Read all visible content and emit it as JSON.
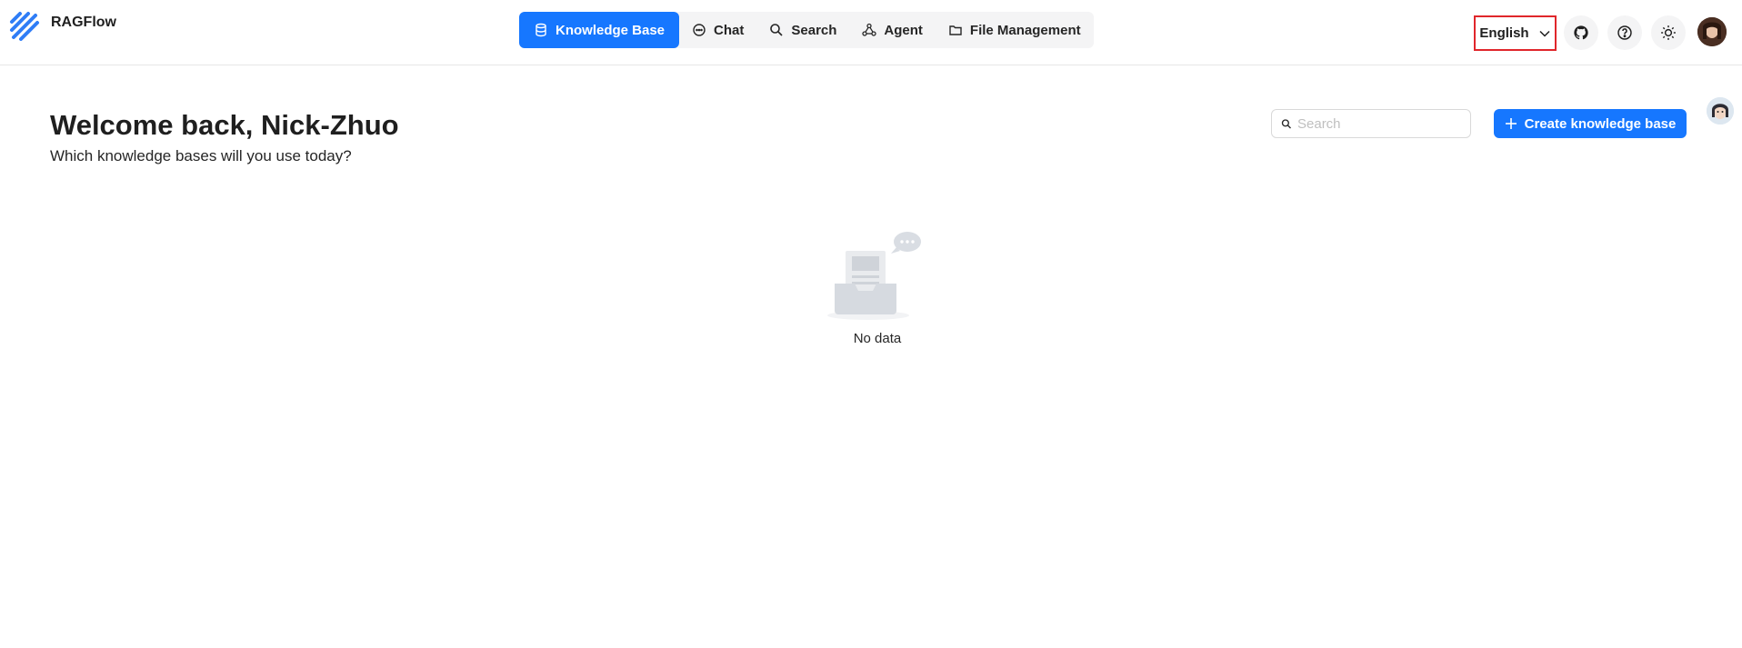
{
  "app": {
    "name": "RAGFlow"
  },
  "nav": {
    "items": [
      {
        "label": "Knowledge Base",
        "icon": "database-icon",
        "active": true
      },
      {
        "label": "Chat",
        "icon": "chat-bubble-icon"
      },
      {
        "label": "Search",
        "icon": "search-icon"
      },
      {
        "label": "Agent",
        "icon": "agent-graph-icon"
      },
      {
        "label": "File Management",
        "icon": "folder-icon"
      }
    ]
  },
  "header": {
    "language": "English",
    "icons": [
      "github-icon",
      "help-icon",
      "sun-icon"
    ]
  },
  "main": {
    "welcome": "Welcome back, Nick-Zhuo",
    "subtitle": "Which knowledge bases will you use today?",
    "search_placeholder": "Search",
    "create_button": "Create knowledge base",
    "empty_text": "No data"
  },
  "colors": {
    "accent": "#1677ff",
    "highlight_border": "#e0262b"
  }
}
